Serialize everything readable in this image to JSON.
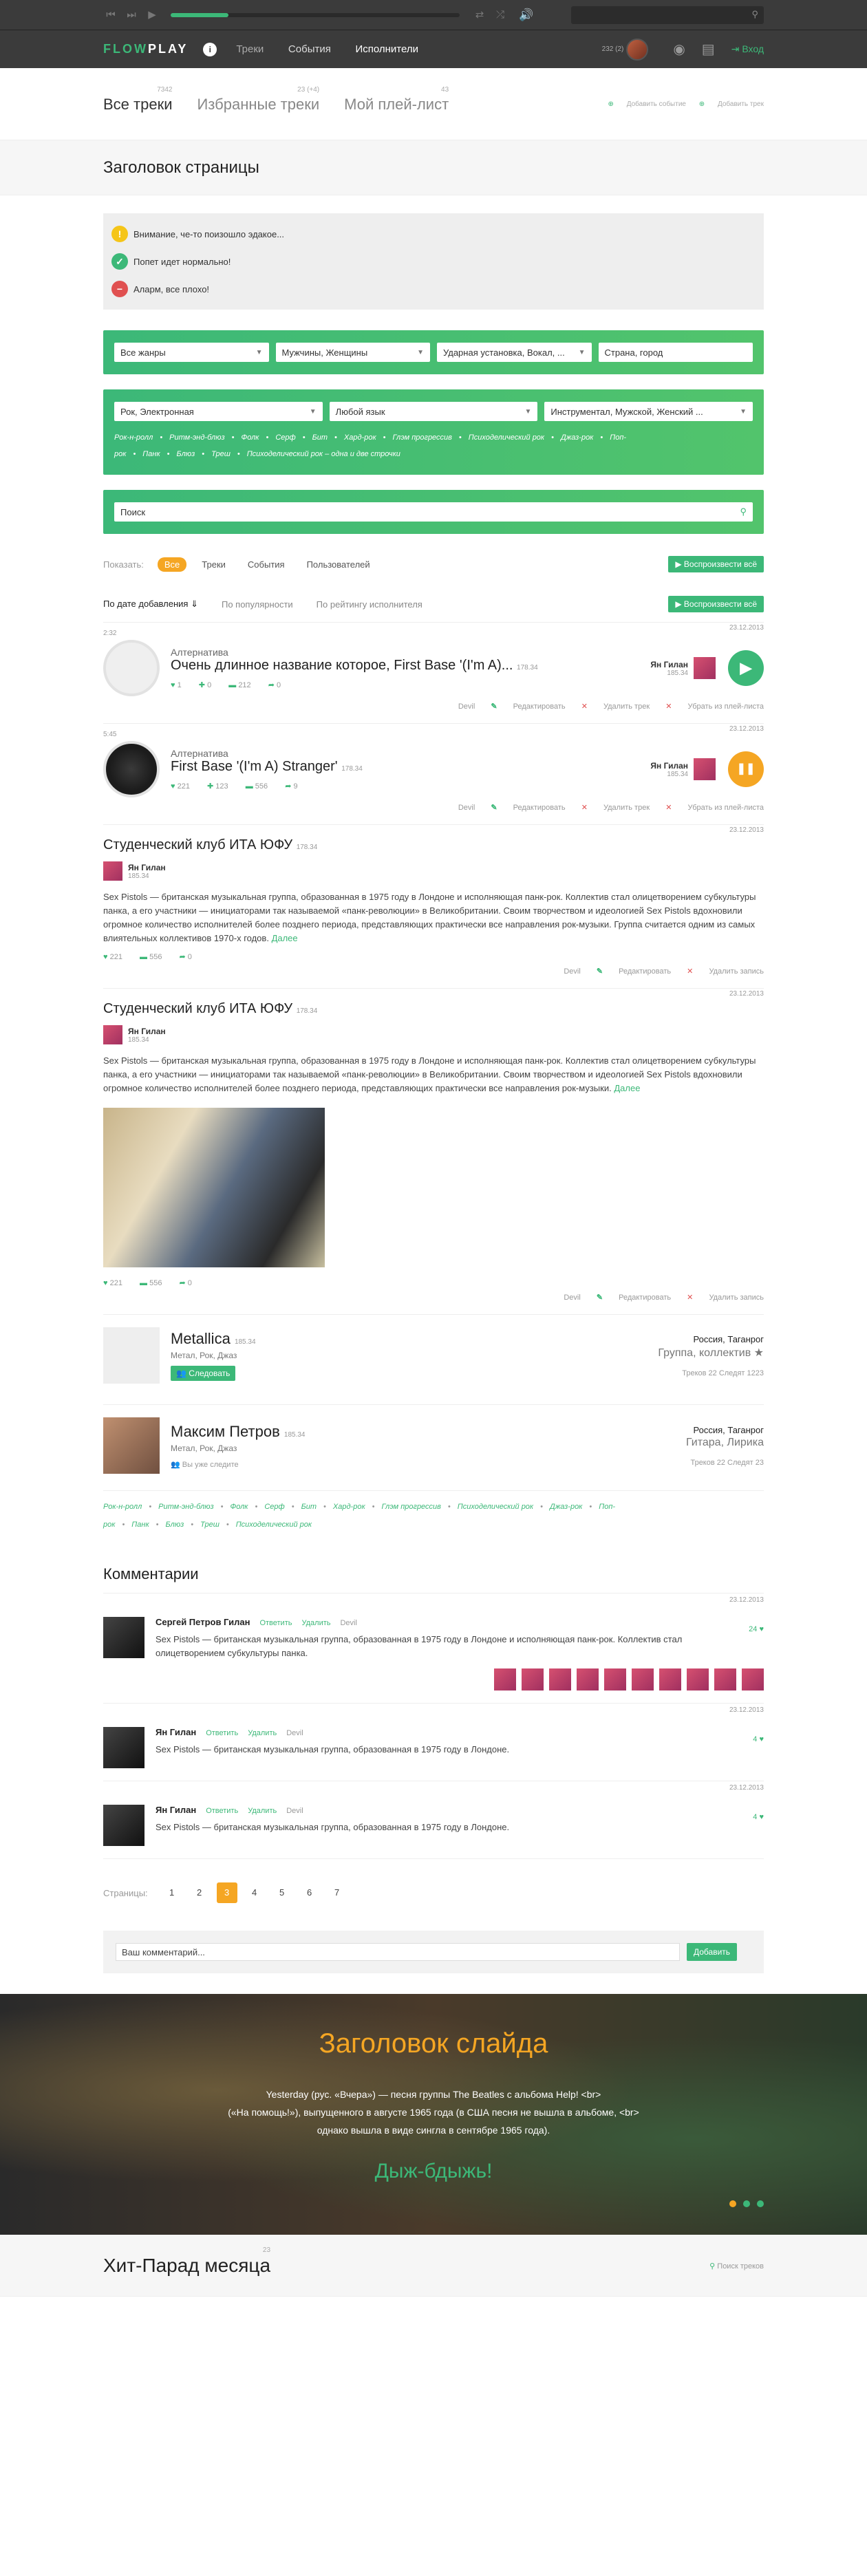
{
  "player": {
    "progress": 0.2
  },
  "nav": {
    "logo_a": "FLOW",
    "logo_b": "PLAY",
    "info": "i",
    "items": [
      "Треки",
      "События",
      "Исполнители"
    ],
    "avatar_count": "232 (2)",
    "login": "Вход"
  },
  "tabs": {
    "items": [
      {
        "label": "Все треки",
        "count": "7342"
      },
      {
        "label": "Избранные треки",
        "count": "23 (+4)"
      },
      {
        "label": "Мой плей-лист",
        "count": "43"
      }
    ],
    "add_event": "Добавить событие",
    "add_track": "Добавить трек"
  },
  "page": {
    "title": "Заголовок страницы"
  },
  "alerts": [
    {
      "text": "Внимание, че-то поизошло эдакое...",
      "icon": "!",
      "color": "#f5c518"
    },
    {
      "text": "Попет идет нормально!",
      "icon": "✓",
      "color": "#3cb878"
    },
    {
      "text": "Аларм, все плохо!",
      "icon": "−",
      "color": "#e05050"
    }
  ],
  "filters1": [
    "Все жанры",
    "Мужчины, Женщины",
    "Ударная установка, Вокал, ...",
    "Страна, город"
  ],
  "filters2": [
    "Рок, Электронная",
    "Любой язык",
    "Инструментал, Мужской, Женский ..."
  ],
  "filter_tags": [
    "Рок-н-ролл",
    "Ритм-энд-блюз",
    "Фолк",
    "Серф",
    "Бит",
    "Хард-рок",
    "Глэм прогрессив",
    "Психоделический рок",
    "Джаз-рок",
    "Поп-рок",
    "Панк",
    "Блюз",
    "Треш",
    "Психоделический рок – одна и две строчки"
  ],
  "search": {
    "value": "Поиск"
  },
  "show": {
    "label": "Показать:",
    "items": [
      "Все",
      "Треки",
      "События",
      "Пользователей"
    ],
    "play_all": "Воспроизвести всё"
  },
  "sort": {
    "items": [
      "По дате добавления ⇓",
      "По популярности",
      "По рейтингу исполнителя"
    ],
    "play_all": "Воспроизвести всё"
  },
  "tracks": [
    {
      "time": "2:32",
      "date": "23.12.2013",
      "genre": "Алтернатива",
      "title": "Очень длинное название которое, First Base '(I'm A)...",
      "plays": "178.34",
      "artist": "Ян Гилан",
      "artist_sub": "185.34",
      "likes": "1",
      "adds": "0",
      "comments": "212",
      "shares": "0",
      "play_icon": "▶",
      "play_color": "#3cb878",
      "actions": [
        "Devil",
        "Редактировать",
        "Удалить трек",
        "Убрать из плей-листа"
      ]
    },
    {
      "time": "5:45",
      "date": "23.12.2013",
      "genre": "Алтернатива",
      "title": "First Base '(I'm A) Stranger'",
      "plays": "178.34",
      "artist": "Ян Гилан",
      "artist_sub": "185.34",
      "likes": "221",
      "adds": "123",
      "comments": "556",
      "shares": "9",
      "play_icon": "❚❚",
      "play_color": "#f5a623",
      "actions": [
        "Devil",
        "Редактировать",
        "Удалить трек",
        "Убрать из плей-листа"
      ]
    }
  ],
  "posts": [
    {
      "date": "23.12.2013",
      "title": "Студенческий клуб ИТА ЮФУ",
      "sub": "178.34",
      "author": "Ян Гилан",
      "author_sub": "185.34",
      "text": "Sex Pistols — британская музыкальная группа, образованная в 1975 году в Лондоне и исполняющая панк-рок. Коллектив стал олицетворением субкультуры панка, а его участники — инициаторами так называемой «панк-революции» в Великобритании. Своим творчеством и идеологией Sex Pistols вдохновили огромное количество исполнителей более позднего периода, представляющих практически все направления рок-музыки. Группа считается одним из самых влиятельных коллективов 1970-х годов.",
      "more": "Далее",
      "likes": "221",
      "comments": "556",
      "shares": "0",
      "actions": [
        "Devil",
        "Редактировать",
        "Удалить запись"
      ]
    },
    {
      "date": "23.12.2013",
      "title": "Студенческий клуб ИТА ЮФУ",
      "sub": "178.34",
      "author": "Ян Гилан",
      "author_sub": "185.34",
      "text": "Sex Pistols — британская музыкальная группа, образованная в 1975 году в Лондоне и исполняющая панк-рок. Коллектив стал олицетворением субкультуры панка, а его участники — инициаторами так называемой «панк-революции» в Великобритании. Своим творчеством и идеологией Sex Pistols вдохновили огромное количество исполнителей более позднего периода, представляющих практически все направления рок-музыки.",
      "more": "Далее",
      "likes": "221",
      "comments": "556",
      "shares": "0",
      "actions": [
        "Devil",
        "Редактировать",
        "Удалить запись"
      ]
    }
  ],
  "artists": [
    {
      "name": "Metallica",
      "sub": "185.34",
      "genres": "Метал, Рок, Джаз",
      "action": "Следовать",
      "loc": "Россия, Таганрог",
      "kind": "Группа, коллектив ★",
      "nums": "Треков 22  Следят 1223"
    },
    {
      "name": "Максим Петров",
      "sub": "185.34",
      "genres": "Метал, Рок, Джаз",
      "action": "Вы уже следите",
      "loc": "Россия, Таганрог",
      "kind": "Гитара, Лирика",
      "nums": "Треков 22  Следят 23"
    }
  ],
  "bottom_tags": [
    "Рок-н-ролл",
    "Ритм-энд-блюз",
    "Фолк",
    "Серф",
    "Бит",
    "Хард-рок",
    "Глэм прогрессив",
    "Психоделический рок",
    "Джаз-рок",
    "Поп-рок",
    "Панк",
    "Блюз",
    "Треш",
    "Психоделический рок"
  ],
  "comments": {
    "title": "Комментарии",
    "items": [
      {
        "date": "23.12.2013",
        "name": "Сергей Петров Гилан",
        "reply": "Ответить",
        "del": "Удалить",
        "extra": "Devil",
        "text": "Sex Pistols — британская музыкальная группа, образованная в 1975 году в Лондоне и исполняющая панк-рок. Коллектив стал олицетворением субкультуры панка.",
        "likes": "24 ♥"
      },
      {
        "date": "23.12.2013",
        "name": "Ян Гилан",
        "reply": "Ответить",
        "del": "Удалить",
        "extra": "Devil",
        "text": "Sex Pistols — британская музыкальная группа, образованная в 1975 году в Лондоне.",
        "likes": "4 ♥"
      },
      {
        "date": "23.12.2013",
        "name": "Ян Гилан",
        "reply": "Ответить",
        "del": "Удалить",
        "extra": "Devil",
        "text": "Sex Pistols — британская музыкальная группа, образованная в 1975 году в Лондоне.",
        "likes": "4 ♥"
      }
    ]
  },
  "pagination": {
    "label": "Страницы:",
    "pages": [
      "1",
      "2",
      "3",
      "4",
      "5",
      "6",
      "7"
    ],
    "active": 2
  },
  "comment_form": {
    "placeholder": "Ваш комментарий...",
    "button": "Добавить"
  },
  "slide": {
    "title": "Заголовок слайда",
    "line1": "Yesterday (рус. «Вчера») — песня группы The Beatles с альбома Help! <br>",
    "line2": "(«На помощь!»), выпущенного в августе 1965 года (в США песня не вышла в альбоме,  <br>",
    "line3": "однако вышла в виде сингла в сентябре 1965 года).",
    "subtitle": "Дыж-бдыжь!"
  },
  "hit": {
    "title": "Хит-Парад месяца",
    "count": "23",
    "search": "Поиск треков"
  }
}
